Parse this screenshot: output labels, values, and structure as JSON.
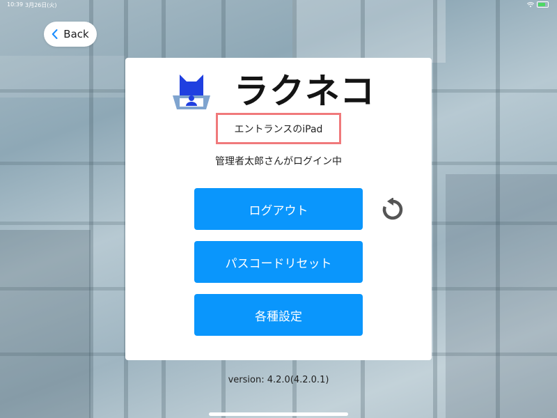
{
  "status_bar": {
    "time": "10:39",
    "date": "3月26日(火)"
  },
  "back": {
    "label": "Back",
    "icon": "chevron-left-icon"
  },
  "app": {
    "logo_text": "ラクネコ",
    "logo_icon": "cat-logo-icon",
    "device_name": "エントランスのiPad",
    "login_status": "管理者太郎さんがログイン中"
  },
  "actions": {
    "logout_label": "ログアウト",
    "passcode_reset_label": "パスコードリセット",
    "settings_label": "各種設定",
    "refresh_icon": "refresh-icon"
  },
  "footer": {
    "version": "version: 4.2.0(4.2.0.1)"
  },
  "colors": {
    "accent": "#0a96fc",
    "highlight_border": "#f0797b",
    "logo_blue": "#1f3fe0",
    "logo_tray": "#7fa4cf"
  }
}
